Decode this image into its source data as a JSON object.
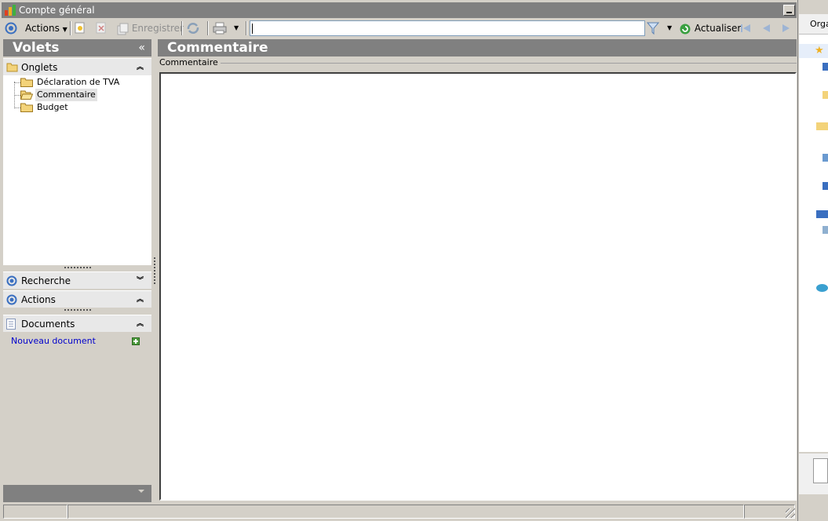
{
  "window": {
    "title": "Compte général"
  },
  "toolbar": {
    "actions_label": "Actions",
    "save_label": "Enregistrer",
    "search_value": "",
    "refresh_label": "Actualiser"
  },
  "left_panel": {
    "header": "Volets",
    "collapse_glyph": "«",
    "sections": {
      "onglets": "Onglets",
      "recherche": "Recherche",
      "actions": "Actions",
      "documents": "Documents"
    },
    "tree_items": [
      {
        "label": "Déclaration de TVA",
        "selected": false
      },
      {
        "label": "Commentaire",
        "selected": true
      },
      {
        "label": "Budget",
        "selected": false
      }
    ],
    "new_document_link": "Nouveau document"
  },
  "content": {
    "header": "Commentaire",
    "group_label": "Commentaire",
    "text_value": ""
  },
  "background_window": {
    "partial_label": "Orga"
  },
  "colors": {
    "header_gray": "#808080",
    "panel_bg": "#d4d0c8",
    "link_blue": "#0000cc"
  }
}
